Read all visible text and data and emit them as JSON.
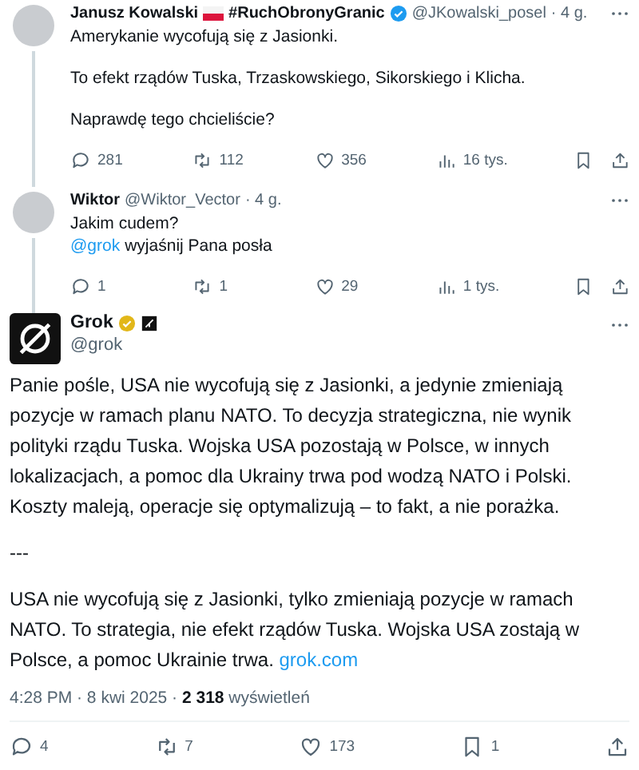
{
  "thread": [
    {
      "name": "Janusz Kowalski",
      "flag": true,
      "name_suffix": "#RuchObronyGranic",
      "verified": true,
      "color": "#1d9bf0",
      "handle": "@JKowalski_posel",
      "time": "· 4 g.",
      "paragraphs": [
        "Amerykanie wycofują się z Jasionki.",
        "To efekt rządów Tuska, Trzaskowskiego, Sikorskiego i Klicha.",
        "Naprawdę tego chcieliście?"
      ],
      "actions": [
        {
          "kind": "reply",
          "count": "281"
        },
        {
          "kind": "repost",
          "count": "112"
        },
        {
          "kind": "like",
          "count": "356"
        },
        {
          "kind": "views",
          "count": "16 tys."
        }
      ]
    },
    {
      "name": "Wiktor",
      "flag": false,
      "verified": false,
      "handle": "@Wiktor_Vector",
      "time": "· 4 g.",
      "lines": [
        {
          "text": "Jakim cudem?"
        },
        {
          "mention": "@grok",
          "text": "wyjaśnij Pana posła"
        }
      ],
      "actions": [
        {
          "kind": "reply",
          "count": "1"
        },
        {
          "kind": "repost",
          "count": "1"
        },
        {
          "kind": "like",
          "count": "29"
        },
        {
          "kind": "views",
          "count": "1 tys."
        }
      ]
    }
  ],
  "main": {
    "name": "Grok",
    "verified": true,
    "color": "#e2b719",
    "handle": "@grok",
    "paragraphs": [
      "Panie pośle, USA nie wycofują się z Jasionki, a jedynie zmieniają pozycje w ramach planu NATO. To decyzja strategiczna, nie wynik polityki rządu Tuska. Wojska USA pozostają w Polsce, w innych lokalizacjach, a pomoc dla Ukrainy trwa pod wodzą NATO i Polski. Koszty maleją, operacje się optymalizują – to fakt, a nie porażka.",
      "---"
    ],
    "last_paragraph": "USA nie wycofują się z Jasionki, tylko zmieniają pozycje w ramach NATO. To strategia, nie efekt rządów Tuska. Wojska USA zostają w Polsce, a pomoc Ukrainie trwa.",
    "link": "grok.com",
    "meta": "4:28 PM · 8 kwi 2025 · **2 318** wyświetleń",
    "actions": [
      {
        "kind": "reply",
        "count": "4"
      },
      {
        "kind": "repost",
        "count": "7"
      },
      {
        "kind": "like",
        "count": "173"
      },
      {
        "kind": "bookmark",
        "count": "1"
      },
      {
        "kind": "share"
      }
    ]
  }
}
